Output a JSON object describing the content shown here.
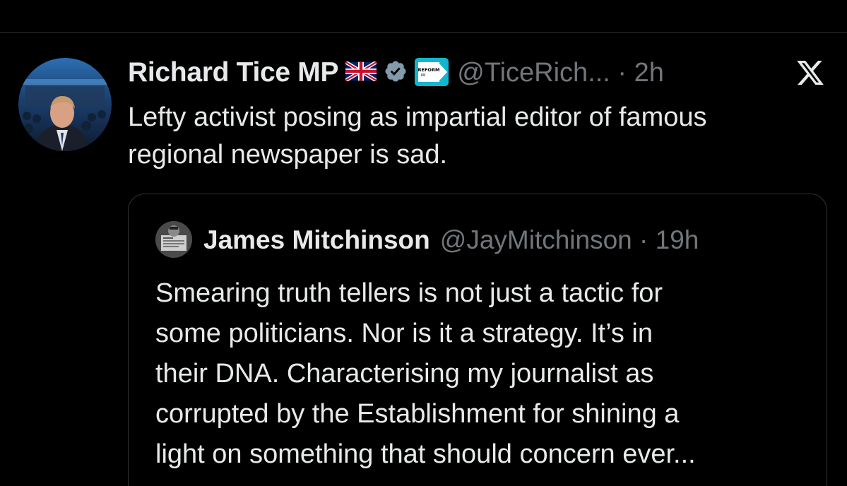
{
  "tweet": {
    "author_name": "Richard Tice MP",
    "handle_time": "@TiceRich... · 2h",
    "text": "Lefty activist posing as impartial editor of famous\nregional newspaper is sad.",
    "badges": [
      "uk-flag-icon",
      "verified-badge-icon",
      "reform-uk-badge-icon"
    ],
    "reform_badge_text": {
      "line1": "REFORM",
      "line2": "UK"
    },
    "close_icon": "x-logo-icon"
  },
  "quoted_tweet": {
    "author_name": "James Mitchinson",
    "handle_time": "@JayMitchinson · 19h",
    "text": "Smearing truth tellers is not just a tactic for\nsome politicians. Nor is it a strategy. It’s in\ntheir DNA. Characterising my journalist as\ncorrupted by the Establishment for shining a\nlight on something that should concern ever..."
  },
  "colors": {
    "background": "#000000",
    "text_primary": "#e7e9ea",
    "text_secondary": "#71767b",
    "border": "#2f3336",
    "verified_badge": "#829aab",
    "reform_badge": "#12b6cf"
  }
}
